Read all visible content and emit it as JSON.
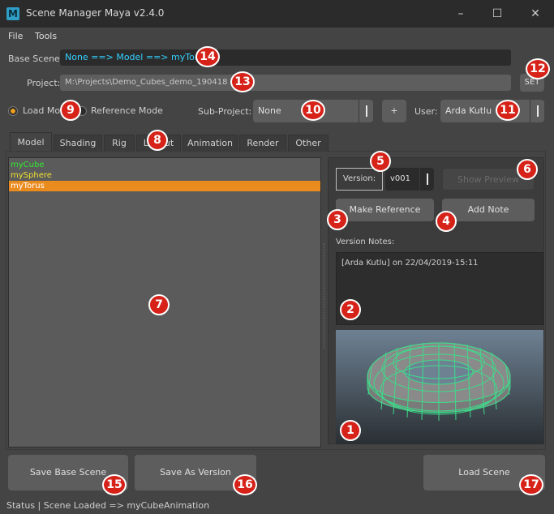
{
  "window": {
    "icon_letter": "M",
    "title": "Scene Manager Maya v2.4.0",
    "minimize": "–",
    "maximize": "☐",
    "close": "✕"
  },
  "menu": [
    "File",
    "Tools"
  ],
  "base_scene": {
    "label": "Base Scene:",
    "value": "None ==> Model ==> myTorus",
    "color": "#33d0ff"
  },
  "project": {
    "label": "Project:",
    "path": "M:\\Projects\\Demo_Cubes_demo_190418",
    "set_label": "SET"
  },
  "mode": {
    "load_label": "Load Mode",
    "reference_label": "Reference Mode",
    "selected": "load"
  },
  "sub_project": {
    "label": "Sub-Project:",
    "value": "None",
    "add_label": "+"
  },
  "user": {
    "label": "User:",
    "value": "Arda Kutlu"
  },
  "tabs": [
    {
      "label": "Model",
      "active": true
    },
    {
      "label": "Shading",
      "active": false
    },
    {
      "label": "Rig",
      "active": false
    },
    {
      "label": "Layout",
      "active": false
    },
    {
      "label": "Animation",
      "active": false
    },
    {
      "label": "Render",
      "active": false
    },
    {
      "label": "Other",
      "active": false
    }
  ],
  "scene_list": [
    {
      "name": "myCube",
      "color": "#33e833",
      "selected": false
    },
    {
      "name": "mySphere",
      "color": "#f0e030",
      "selected": false
    },
    {
      "name": "myTorus",
      "color": "#ffffff",
      "selected": true
    }
  ],
  "version": {
    "label": "Version:",
    "value": "v001",
    "show_preview": "Show Preview",
    "make_reference": "Make Reference",
    "add_note": "Add Note",
    "notes_label": "Version Notes:",
    "notes_text": "[Arda Kutlu] on 22/04/2019-15:11"
  },
  "buttons": {
    "save_base_scene": "Save Base Scene",
    "save_as_version": "Save As Version",
    "load_scene": "Load Scene"
  },
  "status": "Status | Scene Loaded => myCubeAnimation",
  "annotations": [
    "1",
    "2",
    "3",
    "4",
    "5",
    "6",
    "7",
    "8",
    "9",
    "10",
    "11",
    "12",
    "13",
    "14",
    "15",
    "16",
    "17"
  ],
  "colors": {
    "accent": "#f0a020",
    "selection": "#ea8b1e",
    "badge": "#d62218",
    "wireframe": "#3ddc8a"
  }
}
